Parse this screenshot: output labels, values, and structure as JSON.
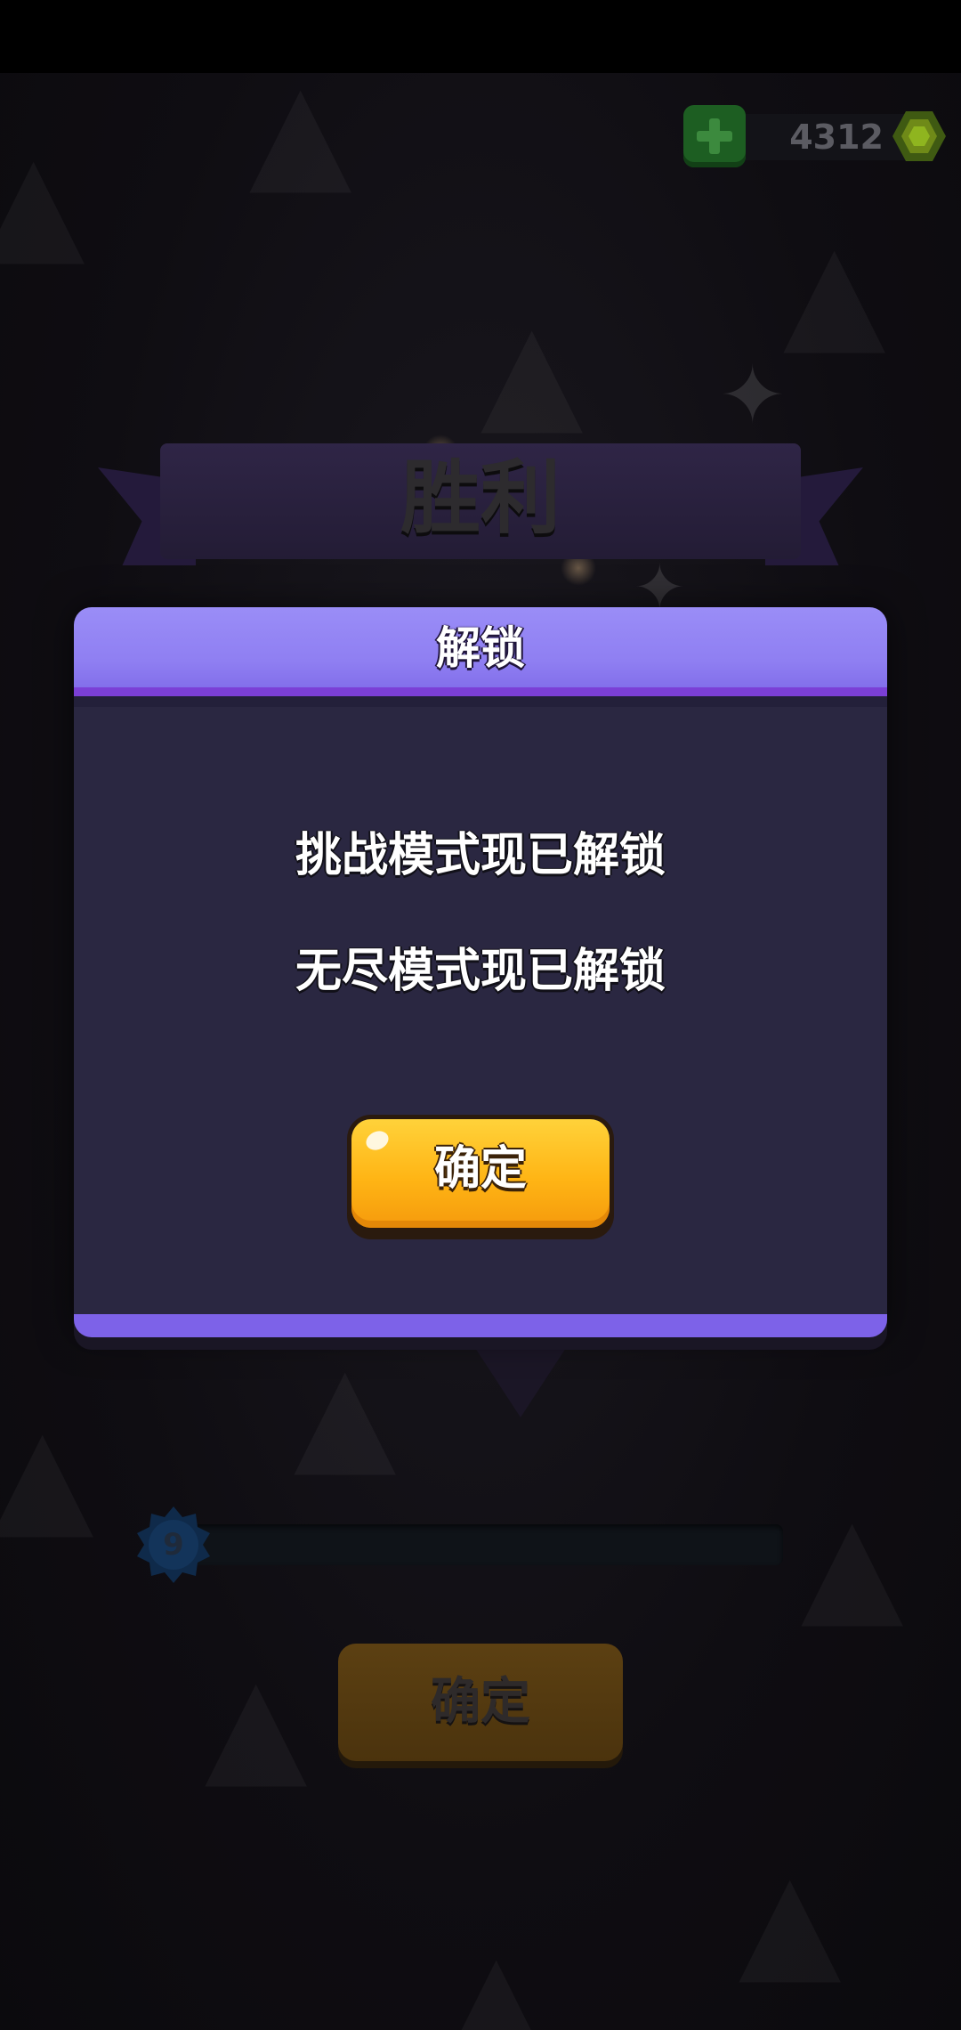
{
  "currency": {
    "amount": "4312",
    "plus_icon": "plus-icon",
    "gem_icon": "gem-icon",
    "plus_color": "#1d5e22",
    "gem_color": "#8fb51f"
  },
  "result": {
    "title": "胜利"
  },
  "progress": {
    "level": "9",
    "fill_fraction": 0.0
  },
  "background_button": {
    "label": "确定"
  },
  "modal": {
    "title": "解锁",
    "messages": [
      "挑战模式现已解锁",
      "无尽模式现已解锁"
    ],
    "confirm_label": "确定",
    "accent_color": "#8f7ff2",
    "button_color": "#ffb515"
  }
}
